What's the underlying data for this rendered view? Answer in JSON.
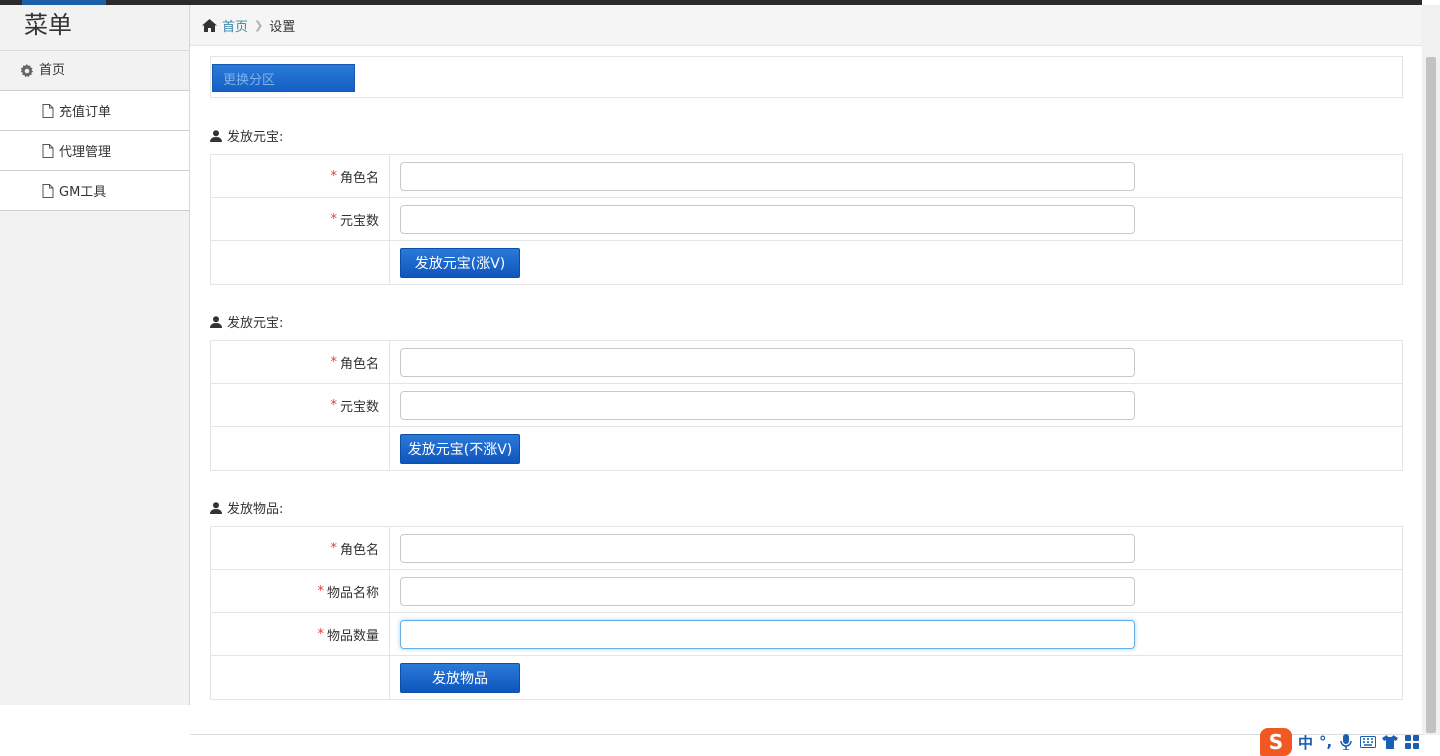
{
  "sidebar": {
    "title": "菜单",
    "home_label": "首页",
    "items": [
      {
        "label": "充值订单"
      },
      {
        "label": "代理管理"
      },
      {
        "label": "GM工具"
      }
    ]
  },
  "breadcrumb": {
    "home": "首页",
    "current": "设置"
  },
  "zone_button": "更换分区",
  "sections": [
    {
      "title": "发放元宝:",
      "fields": [
        {
          "label": "角色名",
          "value": ""
        },
        {
          "label": "元宝数",
          "value": ""
        }
      ],
      "button": "发放元宝(涨V)"
    },
    {
      "title": "发放元宝:",
      "fields": [
        {
          "label": "角色名",
          "value": ""
        },
        {
          "label": "元宝数",
          "value": ""
        }
      ],
      "button": "发放元宝(不涨V)"
    },
    {
      "title": "发放物品:",
      "fields": [
        {
          "label": "角色名",
          "value": ""
        },
        {
          "label": "物品名称",
          "value": ""
        },
        {
          "label": "物品数量",
          "value": ""
        }
      ],
      "button": "发放物品"
    }
  ],
  "required_mark": "*",
  "ime": {
    "logo": "S",
    "mode": "中",
    "punct": "°,"
  },
  "colors": {
    "primary_button": "#1560c4",
    "link": "#3a87ad",
    "required": "#e4393c"
  }
}
